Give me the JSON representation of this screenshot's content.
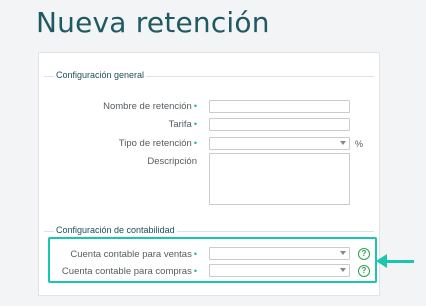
{
  "page": {
    "title": "Nueva retención"
  },
  "general": {
    "section_title": "Configuración general",
    "fields": {
      "nombre": {
        "label": "Nombre de retención",
        "required": "•",
        "value": ""
      },
      "tarifa": {
        "label": "Tarifa",
        "required": "•",
        "value": ""
      },
      "tipo": {
        "label": "Tipo de retención",
        "required": "•",
        "value": "",
        "suffix": "%"
      },
      "descripcion": {
        "label": "Descripción",
        "value": ""
      }
    }
  },
  "contabilidad": {
    "section_title": "Configuración de contabilidad",
    "fields": {
      "ventas": {
        "label": "Cuenta contable para ventas",
        "required": "•",
        "value": "",
        "help": "?"
      },
      "compras": {
        "label": "Cuenta contable para compras",
        "required": "•",
        "value": "",
        "help": "?"
      }
    }
  },
  "colors": {
    "accent": "#1ac6ae",
    "title": "#1f5a63",
    "help": "#27a24a"
  }
}
